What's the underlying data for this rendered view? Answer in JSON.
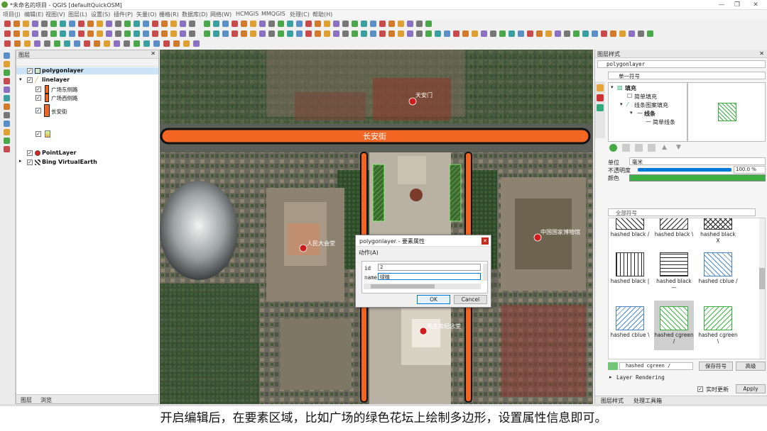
{
  "window": {
    "title": "*未命名的项目 - QGIS [defaultQuickOSM]"
  },
  "menu": [
    "项目(J)",
    "编辑(E)",
    "视图(V)",
    "图层(L)",
    "设置(S)",
    "插件(P)",
    "矢量(O)",
    "栅格(R)",
    "数据库(D)",
    "网络(W)",
    "HCMGIS",
    "MMQGIS",
    "处理(C)",
    "帮助(H)"
  ],
  "layers_panel": {
    "title": "图层",
    "items": {
      "polygonlayer": "polygonlayer",
      "linelayer": "linelayer",
      "rule1": "广场东侧路",
      "rule2": "广场西侧路",
      "rule3": "长安街",
      "pointlayer": "PointLayer",
      "bing": "Bing VirtualEarth"
    },
    "tabs": {
      "layers": "图层",
      "browser": "浏览"
    }
  },
  "map": {
    "labels": {
      "tiananmen": "天安门",
      "changan": "长安街",
      "hall": "人民大会堂",
      "museum": "中国国家博物馆",
      "memorial": "毛主席纪念堂"
    }
  },
  "dialog": {
    "title": "polygonlayer - 要素属性",
    "menu": "动作(A)",
    "fields": {
      "id_label": "id",
      "id_value": "2",
      "name_label": "name",
      "name_value": "绿植"
    },
    "ok": "OK",
    "cancel": "Cancel"
  },
  "style_panel": {
    "title": "图层样式",
    "layer": "polygonlayer",
    "renderer": "单一符号",
    "tree": {
      "fill": "填充",
      "simple_fill": "简单填充",
      "line_fill": "线条图案填充",
      "line": "线条",
      "simple_line": "简单线条"
    },
    "unit_label": "单位",
    "unit_value": "毫米",
    "opacity_label": "不透明度",
    "opacity_value": "100.0 %",
    "color_label": "颜色",
    "color": "#3cb043",
    "search_placeholder": "全部符号",
    "symbols": [
      {
        "label": "hashed black /"
      },
      {
        "label": "hashed black \\"
      },
      {
        "label": "hashed black X"
      },
      {
        "label": "hashed black |"
      },
      {
        "label": "hashed black —"
      },
      {
        "label": "hashed cblue /"
      },
      {
        "label": "hashed cblue \\"
      },
      {
        "label": "hashed cgreen /"
      },
      {
        "label": "hashed cgreen \\"
      }
    ],
    "current_symbol": "hashed cgreen /",
    "save_symbol": "保存符号",
    "advanced": "高级",
    "layer_rendering": "Layer Rendering",
    "live_update": "实时更新",
    "apply": "Apply",
    "tabs": {
      "style": "图层样式",
      "processing": "处理工具箱"
    }
  },
  "subtitle": "开启编辑后，在要素区域，比如广场的绿色花坛上绘制多边形，设置属性信息即可。"
}
